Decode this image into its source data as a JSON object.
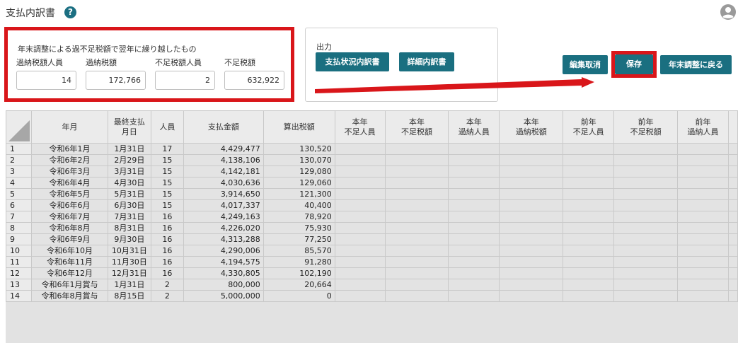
{
  "page": {
    "title": "支払内訳書"
  },
  "carry_over": {
    "title": "年末調整による過不足税額で翌年に繰り越したもの",
    "fields": [
      {
        "label": "過納税額人員",
        "value": "14"
      },
      {
        "label": "過納税額",
        "value": "172,766"
      },
      {
        "label": "不足税額人員",
        "value": "2"
      },
      {
        "label": "不足税額",
        "value": "632,922"
      }
    ]
  },
  "output": {
    "label": "出力",
    "buttons": [
      "支払状況内訳書",
      "詳細内訳書"
    ]
  },
  "actions": {
    "cancel_edit": "編集取消",
    "save": "保存",
    "back": "年末調整に戻る"
  },
  "colors": {
    "accent": "#1a6f80",
    "highlight": "#d9161a"
  },
  "table": {
    "headers": [
      [
        "年月"
      ],
      [
        "最終支払",
        "月日"
      ],
      [
        "人員"
      ],
      [
        "支払金額"
      ],
      [
        "算出税額"
      ],
      [
        "本年",
        "不足人員"
      ],
      [
        "本年",
        "不足税額"
      ],
      [
        "本年",
        "過納人員"
      ],
      [
        "本年",
        "過納税額"
      ],
      [
        "前年",
        "不足人員"
      ],
      [
        "前年",
        "不足税額"
      ],
      [
        "前年",
        "過納人員"
      ]
    ],
    "rows": [
      [
        "1",
        "令和6年1月",
        "1月31日",
        "17",
        "4,429,477",
        "130,520"
      ],
      [
        "2",
        "令和6年2月",
        "2月29日",
        "15",
        "4,138,106",
        "130,070"
      ],
      [
        "3",
        "令和6年3月",
        "3月31日",
        "15",
        "4,142,181",
        "129,080"
      ],
      [
        "4",
        "令和6年4月",
        "4月30日",
        "15",
        "4,030,636",
        "129,060"
      ],
      [
        "5",
        "令和6年5月",
        "5月31日",
        "15",
        "3,914,650",
        "121,300"
      ],
      [
        "6",
        "令和6年6月",
        "6月30日",
        "15",
        "4,017,337",
        "40,400"
      ],
      [
        "7",
        "令和6年7月",
        "7月31日",
        "16",
        "4,249,163",
        "78,920"
      ],
      [
        "8",
        "令和6年8月",
        "8月31日",
        "16",
        "4,226,020",
        "75,930"
      ],
      [
        "9",
        "令和6年9月",
        "9月30日",
        "16",
        "4,313,288",
        "77,250"
      ],
      [
        "10",
        "令和6年10月",
        "10月31日",
        "16",
        "4,290,006",
        "85,570"
      ],
      [
        "11",
        "令和6年11月",
        "11月30日",
        "16",
        "4,194,575",
        "91,280"
      ],
      [
        "12",
        "令和6年12月",
        "12月31日",
        "16",
        "4,330,805",
        "102,190"
      ],
      [
        "13",
        "令和6年1月賞与",
        "1月31日",
        "2",
        "800,000",
        "20,664"
      ],
      [
        "14",
        "令和6年8月賞与",
        "8月15日",
        "2",
        "5,000,000",
        "0"
      ]
    ]
  }
}
